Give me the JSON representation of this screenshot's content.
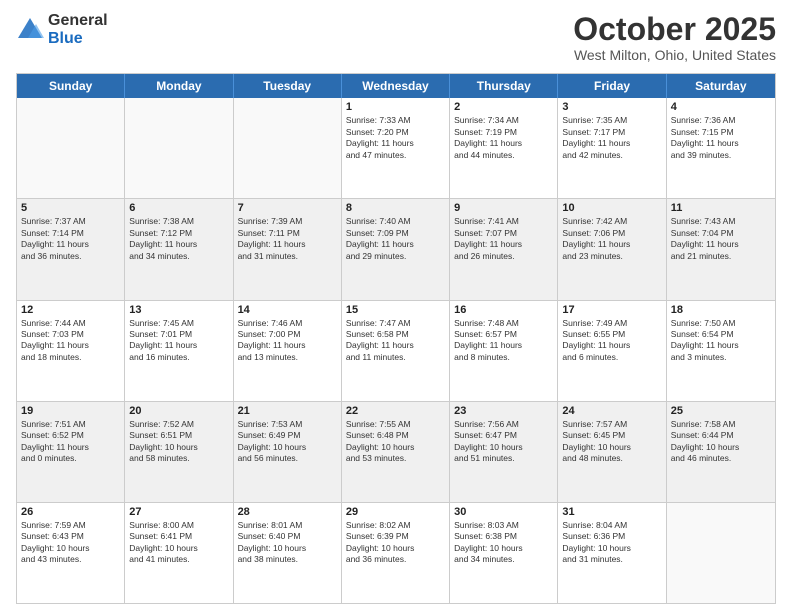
{
  "header": {
    "logo_general": "General",
    "logo_blue": "Blue",
    "month_title": "October 2025",
    "location": "West Milton, Ohio, United States"
  },
  "days_of_week": [
    "Sunday",
    "Monday",
    "Tuesday",
    "Wednesday",
    "Thursday",
    "Friday",
    "Saturday"
  ],
  "rows": [
    [
      {
        "day": "",
        "empty": true,
        "lines": []
      },
      {
        "day": "",
        "empty": true,
        "lines": []
      },
      {
        "day": "",
        "empty": true,
        "lines": []
      },
      {
        "day": "1",
        "lines": [
          "Sunrise: 7:33 AM",
          "Sunset: 7:20 PM",
          "Daylight: 11 hours",
          "and 47 minutes."
        ]
      },
      {
        "day": "2",
        "lines": [
          "Sunrise: 7:34 AM",
          "Sunset: 7:19 PM",
          "Daylight: 11 hours",
          "and 44 minutes."
        ]
      },
      {
        "day": "3",
        "lines": [
          "Sunrise: 7:35 AM",
          "Sunset: 7:17 PM",
          "Daylight: 11 hours",
          "and 42 minutes."
        ]
      },
      {
        "day": "4",
        "lines": [
          "Sunrise: 7:36 AM",
          "Sunset: 7:15 PM",
          "Daylight: 11 hours",
          "and 39 minutes."
        ]
      }
    ],
    [
      {
        "day": "5",
        "shaded": true,
        "lines": [
          "Sunrise: 7:37 AM",
          "Sunset: 7:14 PM",
          "Daylight: 11 hours",
          "and 36 minutes."
        ]
      },
      {
        "day": "6",
        "shaded": true,
        "lines": [
          "Sunrise: 7:38 AM",
          "Sunset: 7:12 PM",
          "Daylight: 11 hours",
          "and 34 minutes."
        ]
      },
      {
        "day": "7",
        "shaded": true,
        "lines": [
          "Sunrise: 7:39 AM",
          "Sunset: 7:11 PM",
          "Daylight: 11 hours",
          "and 31 minutes."
        ]
      },
      {
        "day": "8",
        "shaded": true,
        "lines": [
          "Sunrise: 7:40 AM",
          "Sunset: 7:09 PM",
          "Daylight: 11 hours",
          "and 29 minutes."
        ]
      },
      {
        "day": "9",
        "shaded": true,
        "lines": [
          "Sunrise: 7:41 AM",
          "Sunset: 7:07 PM",
          "Daylight: 11 hours",
          "and 26 minutes."
        ]
      },
      {
        "day": "10",
        "shaded": true,
        "lines": [
          "Sunrise: 7:42 AM",
          "Sunset: 7:06 PM",
          "Daylight: 11 hours",
          "and 23 minutes."
        ]
      },
      {
        "day": "11",
        "shaded": true,
        "lines": [
          "Sunrise: 7:43 AM",
          "Sunset: 7:04 PM",
          "Daylight: 11 hours",
          "and 21 minutes."
        ]
      }
    ],
    [
      {
        "day": "12",
        "lines": [
          "Sunrise: 7:44 AM",
          "Sunset: 7:03 PM",
          "Daylight: 11 hours",
          "and 18 minutes."
        ]
      },
      {
        "day": "13",
        "lines": [
          "Sunrise: 7:45 AM",
          "Sunset: 7:01 PM",
          "Daylight: 11 hours",
          "and 16 minutes."
        ]
      },
      {
        "day": "14",
        "lines": [
          "Sunrise: 7:46 AM",
          "Sunset: 7:00 PM",
          "Daylight: 11 hours",
          "and 13 minutes."
        ]
      },
      {
        "day": "15",
        "lines": [
          "Sunrise: 7:47 AM",
          "Sunset: 6:58 PM",
          "Daylight: 11 hours",
          "and 11 minutes."
        ]
      },
      {
        "day": "16",
        "lines": [
          "Sunrise: 7:48 AM",
          "Sunset: 6:57 PM",
          "Daylight: 11 hours",
          "and 8 minutes."
        ]
      },
      {
        "day": "17",
        "lines": [
          "Sunrise: 7:49 AM",
          "Sunset: 6:55 PM",
          "Daylight: 11 hours",
          "and 6 minutes."
        ]
      },
      {
        "day": "18",
        "lines": [
          "Sunrise: 7:50 AM",
          "Sunset: 6:54 PM",
          "Daylight: 11 hours",
          "and 3 minutes."
        ]
      }
    ],
    [
      {
        "day": "19",
        "shaded": true,
        "lines": [
          "Sunrise: 7:51 AM",
          "Sunset: 6:52 PM",
          "Daylight: 11 hours",
          "and 0 minutes."
        ]
      },
      {
        "day": "20",
        "shaded": true,
        "lines": [
          "Sunrise: 7:52 AM",
          "Sunset: 6:51 PM",
          "Daylight: 10 hours",
          "and 58 minutes."
        ]
      },
      {
        "day": "21",
        "shaded": true,
        "lines": [
          "Sunrise: 7:53 AM",
          "Sunset: 6:49 PM",
          "Daylight: 10 hours",
          "and 56 minutes."
        ]
      },
      {
        "day": "22",
        "shaded": true,
        "lines": [
          "Sunrise: 7:55 AM",
          "Sunset: 6:48 PM",
          "Daylight: 10 hours",
          "and 53 minutes."
        ]
      },
      {
        "day": "23",
        "shaded": true,
        "lines": [
          "Sunrise: 7:56 AM",
          "Sunset: 6:47 PM",
          "Daylight: 10 hours",
          "and 51 minutes."
        ]
      },
      {
        "day": "24",
        "shaded": true,
        "lines": [
          "Sunrise: 7:57 AM",
          "Sunset: 6:45 PM",
          "Daylight: 10 hours",
          "and 48 minutes."
        ]
      },
      {
        "day": "25",
        "shaded": true,
        "lines": [
          "Sunrise: 7:58 AM",
          "Sunset: 6:44 PM",
          "Daylight: 10 hours",
          "and 46 minutes."
        ]
      }
    ],
    [
      {
        "day": "26",
        "lines": [
          "Sunrise: 7:59 AM",
          "Sunset: 6:43 PM",
          "Daylight: 10 hours",
          "and 43 minutes."
        ]
      },
      {
        "day": "27",
        "lines": [
          "Sunrise: 8:00 AM",
          "Sunset: 6:41 PM",
          "Daylight: 10 hours",
          "and 41 minutes."
        ]
      },
      {
        "day": "28",
        "lines": [
          "Sunrise: 8:01 AM",
          "Sunset: 6:40 PM",
          "Daylight: 10 hours",
          "and 38 minutes."
        ]
      },
      {
        "day": "29",
        "lines": [
          "Sunrise: 8:02 AM",
          "Sunset: 6:39 PM",
          "Daylight: 10 hours",
          "and 36 minutes."
        ]
      },
      {
        "day": "30",
        "lines": [
          "Sunrise: 8:03 AM",
          "Sunset: 6:38 PM",
          "Daylight: 10 hours",
          "and 34 minutes."
        ]
      },
      {
        "day": "31",
        "lines": [
          "Sunrise: 8:04 AM",
          "Sunset: 6:36 PM",
          "Daylight: 10 hours",
          "and 31 minutes."
        ]
      },
      {
        "day": "",
        "empty": true,
        "lines": []
      }
    ]
  ]
}
